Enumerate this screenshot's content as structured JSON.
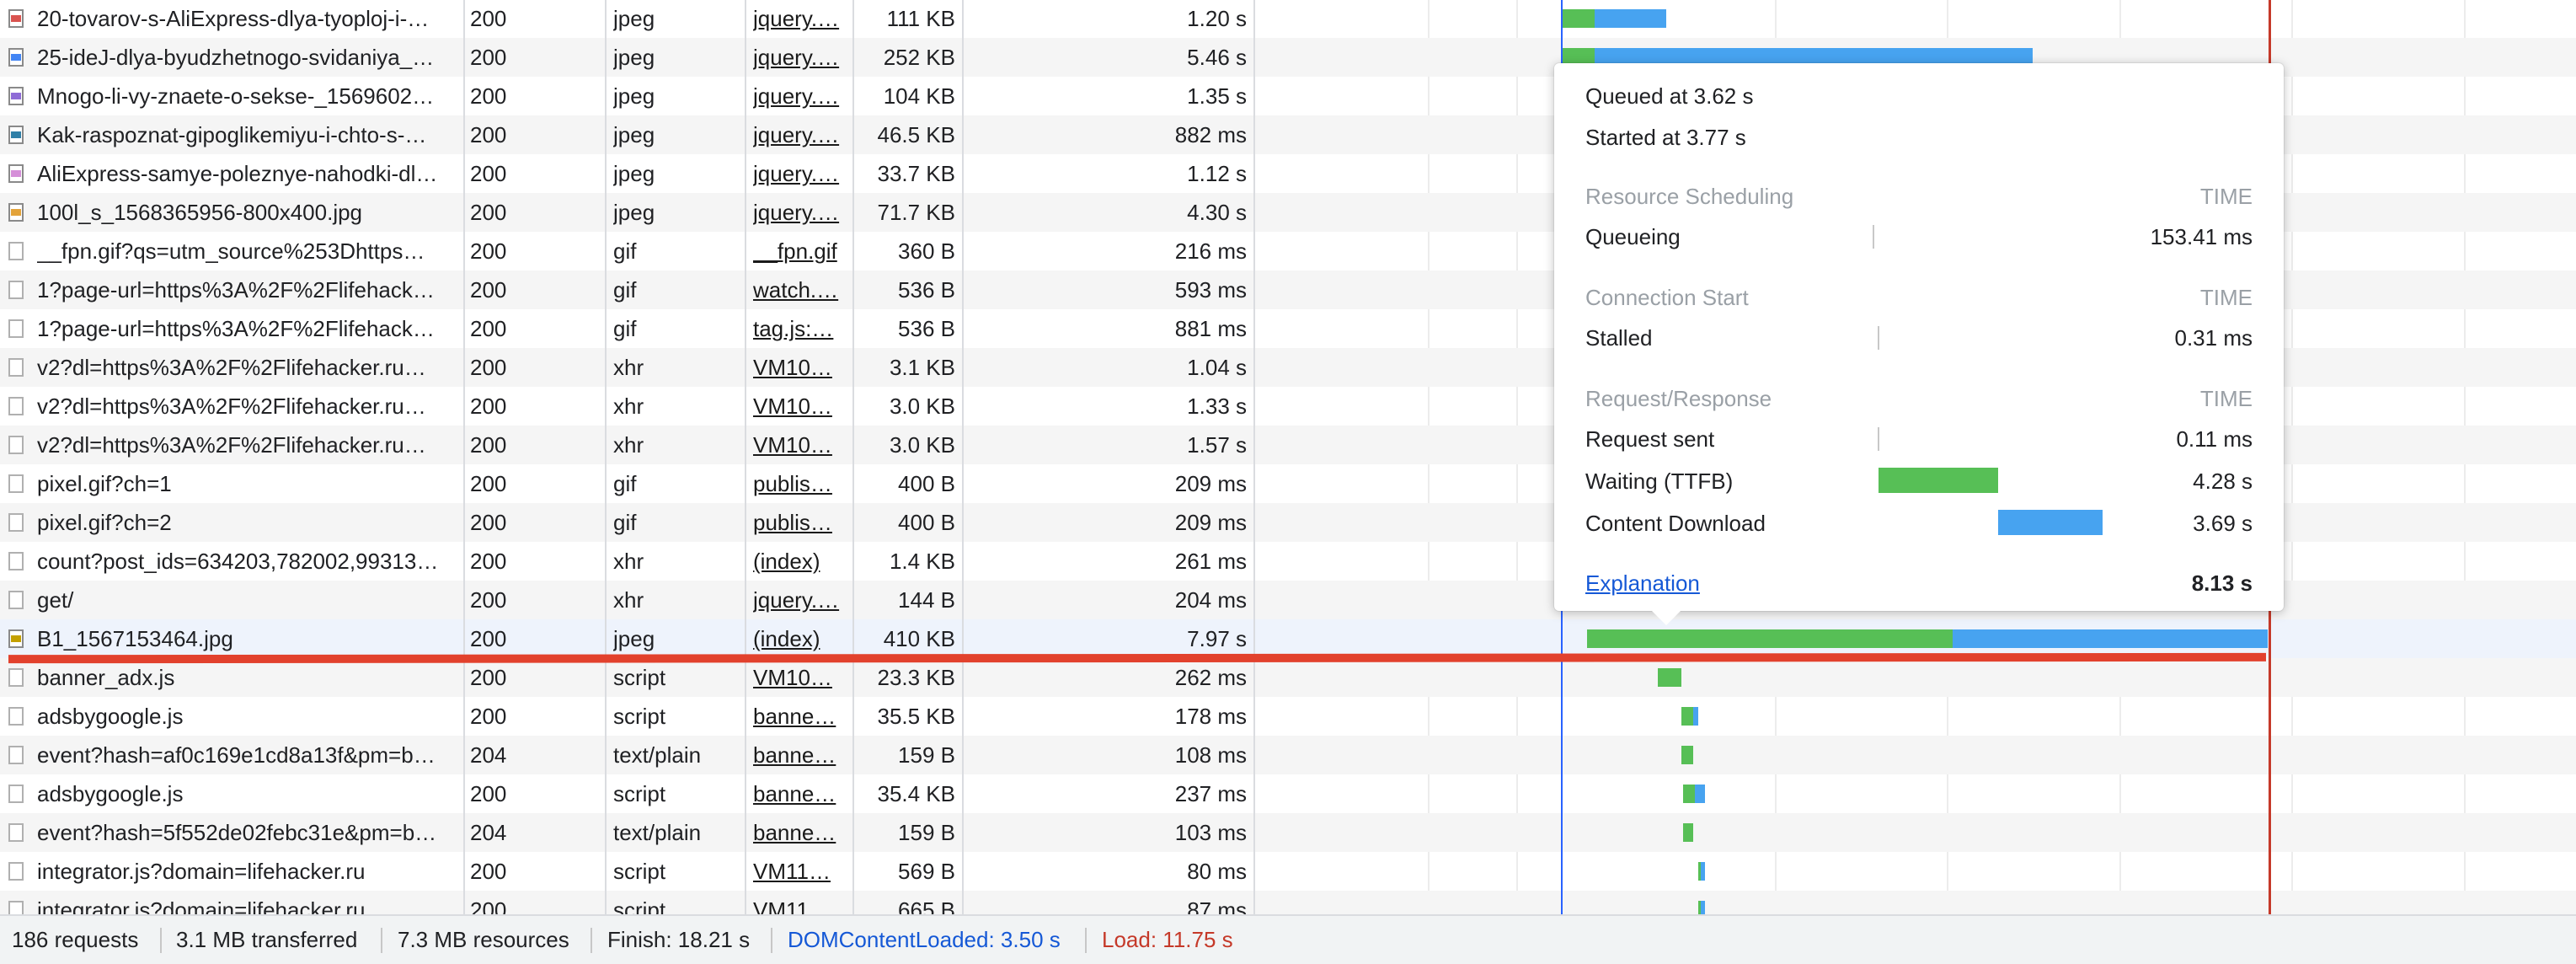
{
  "requests": [
    {
      "name": "20-tovarov-s-AliExpress-dlya-tyoploj-i-…",
      "status": "200",
      "type": "jpeg",
      "initiator": "jquery.…",
      "size": "111 KB",
      "time": "1.20 s",
      "icon": "image-icon",
      "icon_color": "#d9534f"
    },
    {
      "name": "25-ideJ-dlya-byudzhetnogo-svidaniya_…",
      "status": "200",
      "type": "jpeg",
      "initiator": "jquery.…",
      "size": "252 KB",
      "time": "5.46 s",
      "icon": "image-icon",
      "icon_color": "#4285f4"
    },
    {
      "name": "Mnogo-li-vy-znaete-o-sekse-_1569602…",
      "status": "200",
      "type": "jpeg",
      "initiator": "jquery.…",
      "size": "104 KB",
      "time": "1.35 s",
      "icon": "image-icon",
      "icon_color": "#8e6bd6"
    },
    {
      "name": "Kak-raspoznat-gipoglikemiyu-i-chto-s-…",
      "status": "200",
      "type": "jpeg",
      "initiator": "jquery.…",
      "size": "46.5 KB",
      "time": "882 ms",
      "icon": "image-icon",
      "icon_color": "#2f7fa7"
    },
    {
      "name": "AliExpress-samye-poleznye-nahodki-dl…",
      "status": "200",
      "type": "jpeg",
      "initiator": "jquery.…",
      "size": "33.7 KB",
      "time": "1.12 s",
      "icon": "image-icon",
      "icon_color": "#d58fd8"
    },
    {
      "name": "100l_s_1568365956-800x400.jpg",
      "status": "200",
      "type": "jpeg",
      "initiator": "jquery.…",
      "size": "71.7 KB",
      "time": "4.30 s",
      "icon": "image-icon",
      "icon_color": "#e3a33a"
    },
    {
      "name": "__fpn.gif?qs=utm_source%253Dhttps…",
      "status": "200",
      "type": "gif",
      "initiator": "__fpn.gif",
      "size": "360 B",
      "time": "216 ms",
      "icon": "file-icon",
      "icon_color": ""
    },
    {
      "name": "1?page-url=https%3A%2F%2Flifehack…",
      "status": "200",
      "type": "gif",
      "initiator": "watch.…",
      "size": "536 B",
      "time": "593 ms",
      "icon": "file-icon",
      "icon_color": ""
    },
    {
      "name": "1?page-url=https%3A%2F%2Flifehack…",
      "status": "200",
      "type": "gif",
      "initiator": "tag.js:…",
      "size": "536 B",
      "time": "881 ms",
      "icon": "file-icon",
      "icon_color": ""
    },
    {
      "name": "v2?dl=https%3A%2F%2Flifehacker.ru…",
      "status": "200",
      "type": "xhr",
      "initiator": "VM10…",
      "size": "3.1 KB",
      "time": "1.04 s",
      "icon": "file-icon",
      "icon_color": ""
    },
    {
      "name": "v2?dl=https%3A%2F%2Flifehacker.ru…",
      "status": "200",
      "type": "xhr",
      "initiator": "VM10…",
      "size": "3.0 KB",
      "time": "1.33 s",
      "icon": "file-icon",
      "icon_color": ""
    },
    {
      "name": "v2?dl=https%3A%2F%2Flifehacker.ru…",
      "status": "200",
      "type": "xhr",
      "initiator": "VM10…",
      "size": "3.0 KB",
      "time": "1.57 s",
      "icon": "file-icon",
      "icon_color": ""
    },
    {
      "name": "pixel.gif?ch=1",
      "status": "200",
      "type": "gif",
      "initiator": "publis…",
      "size": "400 B",
      "time": "209 ms",
      "icon": "file-icon",
      "icon_color": ""
    },
    {
      "name": "pixel.gif?ch=2",
      "status": "200",
      "type": "gif",
      "initiator": "publis…",
      "size": "400 B",
      "time": "209 ms",
      "icon": "file-icon",
      "icon_color": ""
    },
    {
      "name": "count?post_ids=634203,782002,99313…",
      "status": "200",
      "type": "xhr",
      "initiator": "(index)",
      "size": "1.4 KB",
      "time": "261 ms",
      "icon": "file-icon",
      "icon_color": ""
    },
    {
      "name": "get/",
      "status": "200",
      "type": "xhr",
      "initiator": "jquery.…",
      "size": "144 B",
      "time": "204 ms",
      "icon": "file-icon",
      "icon_color": ""
    },
    {
      "name": "B1_1567153464.jpg",
      "status": "200",
      "type": "jpeg",
      "initiator": "(index)",
      "size": "410 KB",
      "time": "7.97 s",
      "icon": "image-icon",
      "icon_color": "#c4a000",
      "selected": true
    },
    {
      "name": "banner_adx.js",
      "status": "200",
      "type": "script",
      "initiator": "VM10…",
      "size": "23.3 KB",
      "time": "262 ms",
      "icon": "file-icon",
      "icon_color": ""
    },
    {
      "name": "adsbygoogle.js",
      "status": "200",
      "type": "script",
      "initiator": "banne…",
      "size": "35.5 KB",
      "time": "178 ms",
      "icon": "file-icon",
      "icon_color": ""
    },
    {
      "name": "event?hash=af0c169e1cd8a13f&pm=b…",
      "status": "204",
      "type": "text/plain",
      "initiator": "banne…",
      "size": "159 B",
      "time": "108 ms",
      "icon": "file-icon",
      "icon_color": ""
    },
    {
      "name": "adsbygoogle.js",
      "status": "200",
      "type": "script",
      "initiator": "banne…",
      "size": "35.4 KB",
      "time": "237 ms",
      "icon": "file-icon",
      "icon_color": ""
    },
    {
      "name": "event?hash=5f552de02febc31e&pm=b…",
      "status": "204",
      "type": "text/plain",
      "initiator": "banne…",
      "size": "159 B",
      "time": "103 ms",
      "icon": "file-icon",
      "icon_color": ""
    },
    {
      "name": "integrator.js?domain=lifehacker.ru",
      "status": "200",
      "type": "script",
      "initiator": "VM11…",
      "size": "569 B",
      "time": "80 ms",
      "icon": "file-icon",
      "icon_color": ""
    },
    {
      "name": "integrator.js?domain=lifehacker.ru",
      "status": "200",
      "type": "script",
      "initiator": "VM11…",
      "size": "665 B",
      "time": "87 ms",
      "icon": "file-icon",
      "icon_color": ""
    }
  ],
  "timing_popup": {
    "queued_at": "Queued at 3.62 s",
    "started_at": "Started at 3.77 s",
    "time_header": "TIME",
    "sections": [
      {
        "title": "Resource Scheduling",
        "phases": [
          {
            "label": "Queueing",
            "value": "153.41 ms"
          }
        ]
      },
      {
        "title": "Connection Start",
        "phases": [
          {
            "label": "Stalled",
            "value": "0.31 ms"
          }
        ]
      },
      {
        "title": "Request/Response",
        "phases": [
          {
            "label": "Request sent",
            "value": "0.11 ms"
          },
          {
            "label": "Waiting (TTFB)",
            "value": "4.28 s"
          },
          {
            "label": "Content Download",
            "value": "3.69 s"
          }
        ]
      }
    ],
    "explanation_link": "Explanation",
    "total": "8.13 s"
  },
  "status_bar": {
    "requests": "186 requests",
    "transferred": "3.1 MB transferred",
    "resources": "7.3 MB resources",
    "finish": "Finish: 18.21 s",
    "dom_content_loaded": "DOMContentLoaded: 3.50 s",
    "load": "Load: 11.75 s"
  },
  "colors": {
    "waiting": "#57bf56",
    "download": "#47a3f0",
    "dom_content_loaded": "#1558d6",
    "load": "#c53929"
  }
}
